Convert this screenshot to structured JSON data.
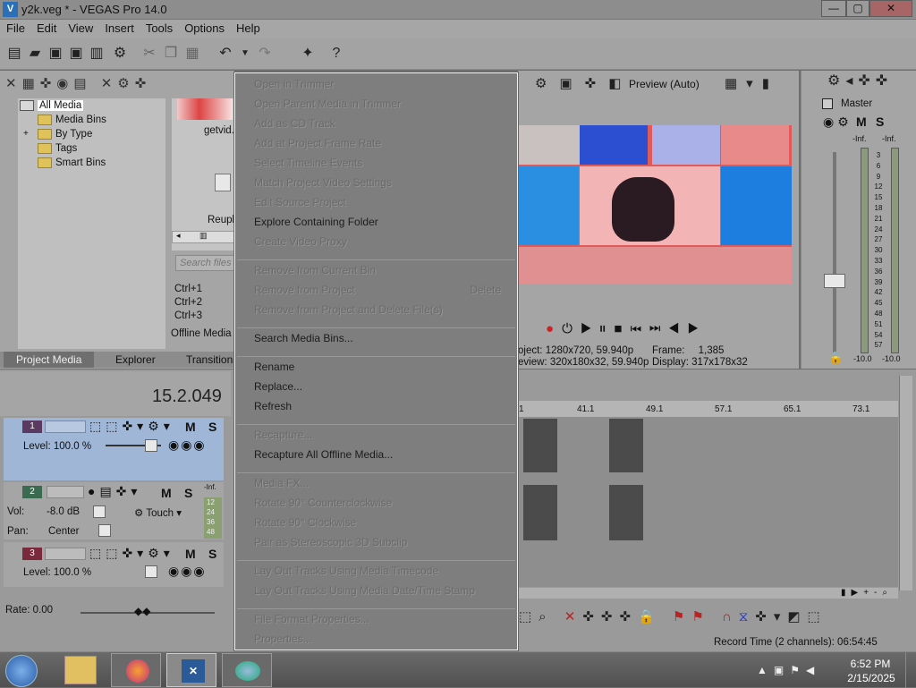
{
  "window": {
    "title": "y2k.veg * - VEGAS Pro 14.0",
    "app_icon": "V",
    "min": "—",
    "max": "▢",
    "close": "✕"
  },
  "menu": [
    "File",
    "Edit",
    "View",
    "Insert",
    "Tools",
    "Options",
    "Help"
  ],
  "media_tree": {
    "items": [
      "All Media",
      "Media Bins",
      "By Type",
      "Tags",
      "Smart Bins"
    ],
    "expander": "+"
  },
  "media_area": {
    "thumb_label": "getvid.",
    "replace_label": "Reupl",
    "search_placeholder": "Search files ta",
    "shortcuts": [
      "Ctrl+1",
      "Ctrl+2",
      "Ctrl+3"
    ],
    "offline_label": "Offline Media F"
  },
  "tabs": [
    "Project Media",
    "Explorer",
    "Transitions"
  ],
  "context_menu": {
    "groups": [
      [
        {
          "label": "Open in Trimmer",
          "enabled": false
        },
        {
          "label": "Open Parent Media in Trimmer",
          "enabled": false
        },
        {
          "label": "Add as CD Track",
          "enabled": false
        },
        {
          "label": "Add at Project Frame Rate",
          "enabled": false
        },
        {
          "label": "Select Timeline Events",
          "enabled": false
        },
        {
          "label": "Match Project Video Settings",
          "enabled": false
        },
        {
          "label": "Edit Source Project",
          "enabled": false
        },
        {
          "label": "Explore Containing Folder",
          "enabled": true
        },
        {
          "label": "Create Video Proxy",
          "enabled": false
        }
      ],
      [
        {
          "label": "Remove from Current Bin",
          "enabled": false
        },
        {
          "label": "Remove from Project",
          "enabled": false,
          "shortcut": "Delete"
        },
        {
          "label": "Remove from Project and Delete File(s)",
          "enabled": false
        }
      ],
      [
        {
          "label": "Search Media Bins...",
          "enabled": true
        }
      ],
      [
        {
          "label": "Rename",
          "enabled": true
        },
        {
          "label": "Replace...",
          "enabled": true
        },
        {
          "label": "Refresh",
          "enabled": true
        }
      ],
      [
        {
          "label": "Recapture...",
          "enabled": false
        },
        {
          "label": "Recapture All Offline Media...",
          "enabled": true
        }
      ],
      [
        {
          "label": "Media FX...",
          "enabled": false
        },
        {
          "label": "Rotate 90° Counterclockwise",
          "enabled": false
        },
        {
          "label": "Rotate 90° Clockwise",
          "enabled": false
        },
        {
          "label": "Pair as Stereoscopic 3D Subclip",
          "enabled": false
        }
      ],
      [
        {
          "label": "Lay Out Tracks Using Media Timecode",
          "enabled": false
        },
        {
          "label": "Lay Out Tracks Using Media Date/Time Stamp",
          "enabled": false
        }
      ],
      [
        {
          "label": "File Format Properties...",
          "enabled": false
        },
        {
          "label": "Properties...",
          "enabled": false
        }
      ]
    ]
  },
  "preview": {
    "mode": "Preview (Auto)",
    "project_label": "oject:",
    "project_value": "1280x720, 59.940p",
    "preview_label": "eview:",
    "preview_value": "320x180x32, 59.940p",
    "frame_label": "Frame:",
    "frame_value": "1,385",
    "display_label": "Display:",
    "display_value": "317x178x32"
  },
  "mixer": {
    "title": "Master",
    "m": "M",
    "s": "S",
    "inf_left": "-Inf.",
    "inf_right": "-Inf.",
    "scale": [
      "3",
      "6",
      "9",
      "12",
      "15",
      "18",
      "21",
      "24",
      "27",
      "30",
      "33",
      "36",
      "39",
      "42",
      "45",
      "48",
      "51",
      "54",
      "57"
    ],
    "bottom_left": "-10.0",
    "bottom_right": "-10.0"
  },
  "timeline": {
    "time": "15.2.049",
    "ruler": [
      "1",
      "41.1",
      "49.1",
      "57.1",
      "65.1",
      "73.1"
    ],
    "tracks": [
      {
        "num": "1",
        "m": "M",
        "s": "S",
        "level_label": "Level: 100.0 %"
      },
      {
        "num": "2",
        "m": "M",
        "s": "S",
        "vol_label": "Vol:",
        "vol_value": "-8.0 dB",
        "pan_label": "Pan:",
        "pan_value": "Center",
        "touch": "Touch",
        "inf": "-Inf.",
        "meter": [
          "12",
          "24",
          "36",
          "48"
        ]
      },
      {
        "num": "3",
        "m": "M",
        "s": "S",
        "level_label": "Level: 100.0 %"
      }
    ],
    "rate": "Rate: 0.00",
    "record_time": "Record Time (2 channels): 06:54:45"
  },
  "taskbar": {
    "time": "6:52 PM",
    "date": "2/15/2025"
  }
}
